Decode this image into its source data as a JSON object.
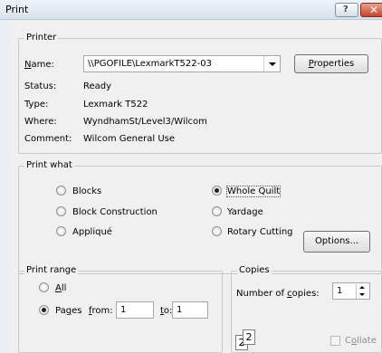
{
  "window": {
    "title": "Print",
    "help_icon": "?",
    "close_icon": "✕"
  },
  "printer": {
    "group_label": "Printer",
    "name_label": "Name:",
    "name_value": "\\\\PGOFILE\\LexmarkT522-03",
    "properties_label": "Properties",
    "status_label": "Status:",
    "status_value": "Ready",
    "type_label": "Type:",
    "type_value": "Lexmark T522",
    "where_label": "Where:",
    "where_value": "WyndhamSt/Level3/Wilcom",
    "comment_label": "Comment:",
    "comment_value": "Wilcom General Use"
  },
  "print_what": {
    "group_label": "Print what",
    "options": [
      {
        "label": "Blocks",
        "selected": false
      },
      {
        "label": "Whole Quilt",
        "selected": true
      },
      {
        "label": "Block Construction",
        "selected": false
      },
      {
        "label": "Yardage",
        "selected": false
      },
      {
        "label": "Appliqué",
        "selected": false
      },
      {
        "label": "Rotary Cutting",
        "selected": false
      }
    ],
    "options_button": "Options..."
  },
  "print_range": {
    "group_label": "Print range",
    "all_label": "All",
    "pages_label": "Pages",
    "from_label": "from:",
    "from_value": "1",
    "to_label": "to:",
    "to_value": "1"
  },
  "copies": {
    "group_label": "Copies",
    "number_label": "Number of copies:",
    "number_value": "1",
    "collate_label": "Collate",
    "page_icons": [
      "2",
      "2"
    ]
  }
}
